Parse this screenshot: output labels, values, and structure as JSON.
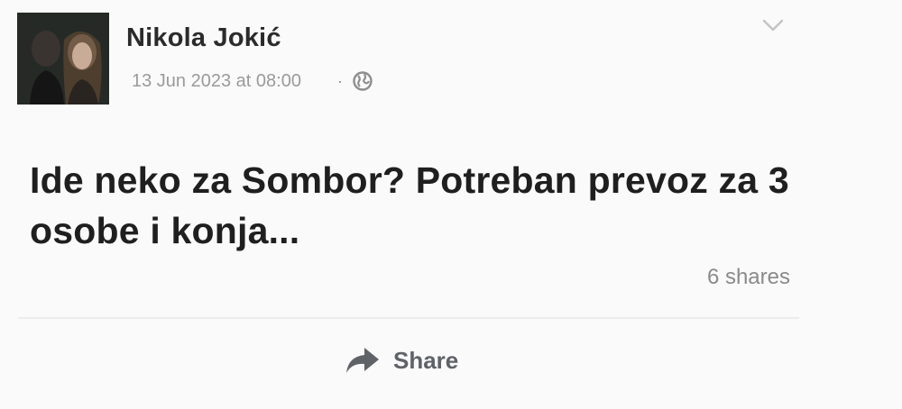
{
  "post": {
    "author": "Nikola Jokić",
    "timestamp": "13 Jun 2023 at 08:00",
    "separator": "·",
    "privacy_icon": "globe-icon",
    "menu_icon": "chevron-down-icon",
    "text": "Ide neko za Sombor? Potreban prevoz za 3 osobe i konja...",
    "shares": "6 shares"
  },
  "actions": {
    "share_label": "Share",
    "share_icon": "share-arrow-icon"
  },
  "colors": {
    "background": "#fafafa",
    "name": "#2b2b2b",
    "meta": "#9a9a9a",
    "action": "#5f6267"
  }
}
